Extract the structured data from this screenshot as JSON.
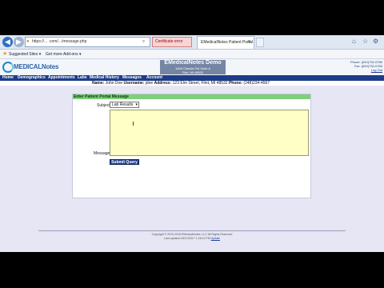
{
  "browser": {
    "url": "https://... .com/.../message.php",
    "certificate_error": "Certificate error",
    "tab_title": "EMedicalNotes Patient Portal",
    "favorites": {
      "suggested_sites": "Suggested Sites ▾",
      "get_more_addons": "Get more Add-ons ▾"
    }
  },
  "header": {
    "logo_text": "MEDICALNotes",
    "clinic_name": "EMedicalNotes Demo",
    "clinic_address": "1626 Chester Rd Suite A",
    "clinic_city": "Flint, MI 48532",
    "phone": "Phone: (810)732-0780",
    "fax": "Fax: (810)732-0783",
    "logout": "Log Out"
  },
  "nav": {
    "items": [
      "Home",
      "Demographics",
      "Appointments",
      "Labs",
      "Medical History",
      "Messages",
      "Account"
    ]
  },
  "patient": {
    "name_label": "Name",
    "name_value": "John Doe",
    "username_label": "Username",
    "username_value": "jdoe",
    "address_label": "Address",
    "address_value": "123 Elm Street, Flint, MI 48532",
    "phone_label": "Phone",
    "phone_value": "(248)234-4567"
  },
  "form": {
    "title": "Enter Patient Portal Message",
    "subject_label": "Subject",
    "subject_value": "Lab Results",
    "message_label": "Message",
    "submit_label": "Submit Query"
  },
  "footer": {
    "copyright": "Copyright © 2010-2018 EMedicalNotes, LLC All Rights Reserved",
    "updated_prefix": "Last updated 06/21/2017 1:16:01 PM",
    "updated_link": "Update"
  }
}
